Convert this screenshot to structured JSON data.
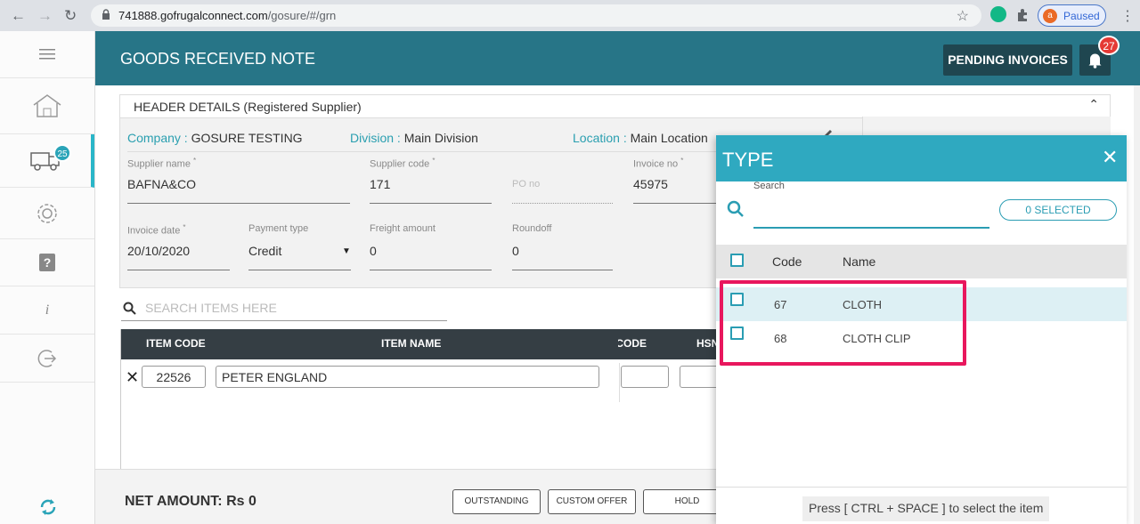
{
  "browser": {
    "url_host": "741888.gofrugalconnect.com",
    "url_path": "/gosure/#/grn",
    "profile_initial": "a",
    "profile_status": "Paused"
  },
  "sidebar": {
    "truck_badge": "25",
    "items": [
      {
        "icon": "menu-icon"
      },
      {
        "icon": "home-icon"
      },
      {
        "icon": "truck-icon"
      },
      {
        "icon": "gear-icon"
      },
      {
        "icon": "help-icon"
      },
      {
        "icon": "info-icon"
      },
      {
        "icon": "logout-icon"
      },
      {
        "icon": "sync-icon"
      }
    ]
  },
  "header": {
    "title": "GOODS RECEIVED NOTE",
    "pending_label": "PENDING INVOICES",
    "notif_count": "27"
  },
  "panel": {
    "title": "HEADER DETAILS (Registered Supplier)",
    "company_label": "Company :",
    "company_value": "GOSURE TESTING",
    "division_label": "Division :",
    "division_value": "Main Division",
    "location_label": "Location :",
    "location_value": "Main Location",
    "supplier_name_label": "Supplier name",
    "supplier_name_value": "BAFNA&CO",
    "supplier_code_label": "Supplier code",
    "supplier_code_value": "171",
    "po_label": "PO no",
    "invoice_no_label": "Invoice no",
    "invoice_no_value": "45975",
    "invoice_date_label": "Invoice date",
    "invoice_date_value": "20/10/2020",
    "payment_type_label": "Payment type",
    "payment_type_value": "Credit",
    "freight_label": "Freight amount",
    "freight_value": "0",
    "roundoff_label": "Roundoff",
    "roundoff_value": "0",
    "required_mark": "*"
  },
  "search_items": {
    "placeholder": "SEARCH ITEMS HERE"
  },
  "table": {
    "columns": [
      "ITEM CODE",
      "ITEM NAME",
      "CODE",
      "HSN"
    ],
    "row": {
      "code": "22526",
      "name": "PETER ENGLAND"
    }
  },
  "footer": {
    "net_amount": "NET AMOUNT:  Rs 0",
    "buttons": [
      "OUTSTANDING",
      "CUSTOM OFFER",
      "HOLD"
    ]
  },
  "dialog": {
    "title": "TYPE",
    "search_label": "Search",
    "selected": "0 SELECTED",
    "col_code": "Code",
    "col_name": "Name",
    "rows": [
      {
        "code": "67",
        "name": "CLOTH"
      },
      {
        "code": "68",
        "name": "CLOTH CLIP"
      }
    ],
    "hint": "Press [ CTRL + SPACE ] to select the item"
  },
  "colors": {
    "header": "#277587",
    "dialog_header": "#2fa9c0",
    "highlight": "#e8175d",
    "badge": "#e53935"
  }
}
